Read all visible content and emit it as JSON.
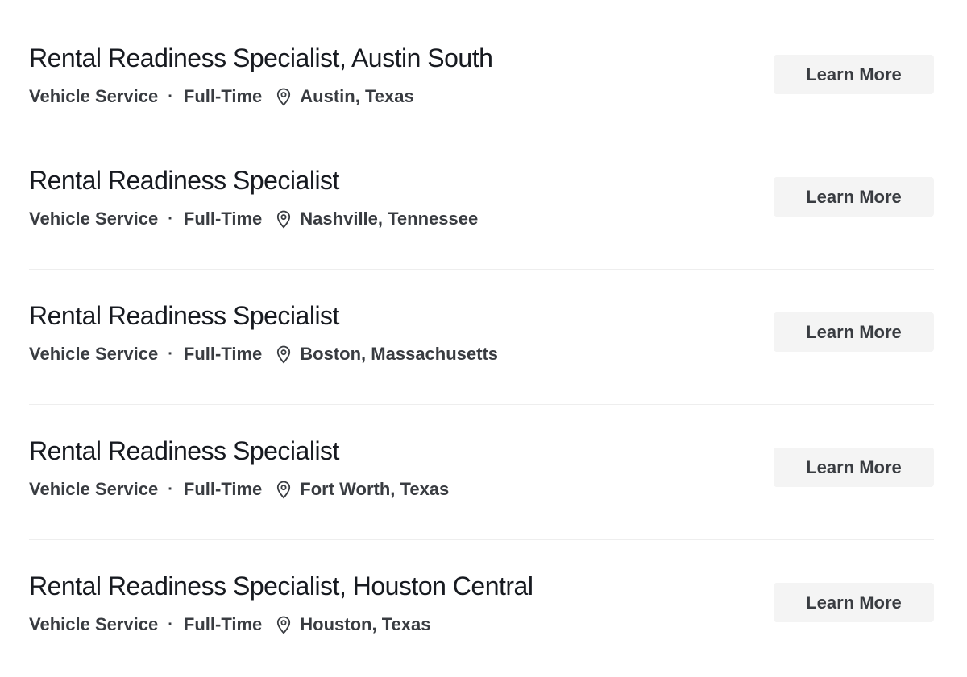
{
  "jobs": [
    {
      "title": "Rental Readiness Specialist, Austin South",
      "department": "Vehicle Service",
      "separator": "·",
      "type": "Full-Time",
      "location": "Austin, Texas",
      "location_icon": "map-pin-icon",
      "button_label": "Learn More"
    },
    {
      "title": "Rental Readiness Specialist",
      "department": "Vehicle Service",
      "separator": "·",
      "type": "Full-Time",
      "location": "Nashville, Tennessee",
      "location_icon": "map-pin-icon",
      "button_label": "Learn More"
    },
    {
      "title": "Rental Readiness Specialist",
      "department": "Vehicle Service",
      "separator": "·",
      "type": "Full-Time",
      "location": "Boston, Massachusetts",
      "location_icon": "map-pin-icon",
      "button_label": "Learn More"
    },
    {
      "title": "Rental Readiness Specialist",
      "department": "Vehicle Service",
      "separator": "·",
      "type": "Full-Time",
      "location": "Fort Worth, Texas",
      "location_icon": "map-pin-icon",
      "button_label": "Learn More"
    },
    {
      "title": "Rental Readiness Specialist, Houston Central",
      "department": "Vehicle Service",
      "separator": "·",
      "type": "Full-Time",
      "location": "Houston, Texas",
      "location_icon": "map-pin-icon",
      "button_label": "Learn More"
    }
  ],
  "colors": {
    "title_text": "#171a20",
    "meta_text": "#393c41",
    "button_bg": "#f4f4f4",
    "divider": "#eeeeee"
  }
}
